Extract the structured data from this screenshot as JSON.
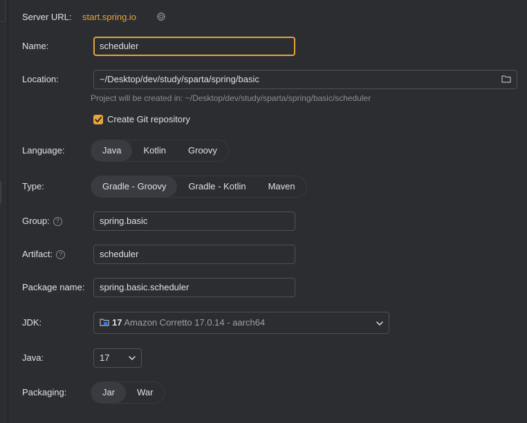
{
  "server": {
    "label": "Server URL:",
    "link": "start.spring.io",
    "settings_icon": "gear-icon"
  },
  "name": {
    "label": "Name:",
    "value": "scheduler"
  },
  "location": {
    "label": "Location:",
    "value": "~/Desktop/dev/study/sparta/spring/basic",
    "hint": "Project will be created in: ~/Desktop/dev/study/sparta/spring/basic/scheduler",
    "browse_icon": "folder-icon"
  },
  "git": {
    "label": "Create Git repository",
    "checked": true
  },
  "language": {
    "label": "Language:",
    "options": [
      "Java",
      "Kotlin",
      "Groovy"
    ],
    "selected": "Java"
  },
  "type": {
    "label": "Type:",
    "options": [
      "Gradle - Groovy",
      "Gradle - Kotlin",
      "Maven"
    ],
    "selected": "Gradle - Groovy"
  },
  "group": {
    "label": "Group:",
    "value": "spring.basic",
    "help_icon": "question-icon"
  },
  "artifact": {
    "label": "Artifact:",
    "value": "scheduler",
    "help_icon": "question-icon"
  },
  "package": {
    "label": "Package name:",
    "value": "spring.basic.scheduler"
  },
  "jdk": {
    "label": "JDK:",
    "version": "17",
    "description": "Amazon Corretto 17.0.14 - aarch64"
  },
  "java": {
    "label": "Java:",
    "value": "17"
  },
  "packaging": {
    "label": "Packaging:",
    "options": [
      "Jar",
      "War"
    ],
    "selected": "Jar"
  },
  "colors": {
    "accent": "#e8a33c",
    "background": "#2b2d30",
    "text": "#dfe1e5",
    "muted": "#8c8f94"
  }
}
